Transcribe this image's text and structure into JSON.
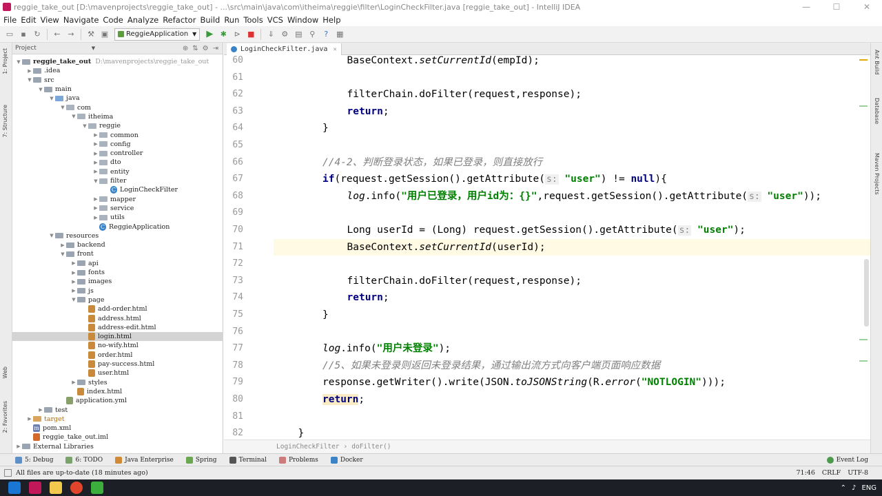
{
  "window": {
    "title": "reggie_take_out [D:\\mavenprojects\\reggie_take_out] - ...\\src\\main\\java\\com\\itheima\\reggie\\filter\\LoginCheckFilter.java [reggie_take_out] - IntelliJ IDEA",
    "minimize": "—",
    "maximize": "☐",
    "close": "✕"
  },
  "menu": [
    "File",
    "Edit",
    "View",
    "Navigate",
    "Code",
    "Analyze",
    "Refactor",
    "Build",
    "Run",
    "Tools",
    "VCS",
    "Window",
    "Help"
  ],
  "toolbar": {
    "run_config": "ReggieApplication"
  },
  "left_strip": {
    "project": "1: Project",
    "structure": "7: Structure",
    "web": "Web",
    "favorites": "2: Favorites"
  },
  "right_strip": {
    "ant": "Ant Build",
    "database": "Database",
    "maven": "Maven Projects"
  },
  "project_panel": {
    "header": "Project",
    "rows": [
      {
        "label": "reggie_take_out",
        "extra": "D:\\mavenprojects\\reggie_take_out",
        "arrow": "▼",
        "type": "folder",
        "bold": true
      },
      {
        "label": ".idea",
        "arrow": "▶",
        "type": "folder"
      },
      {
        "label": "src",
        "arrow": "▼",
        "type": "folder"
      },
      {
        "label": "main",
        "arrow": "▼",
        "type": "folder"
      },
      {
        "label": "java",
        "arrow": "▼",
        "type": "blue"
      },
      {
        "label": "com",
        "arrow": "▼",
        "type": "pkg"
      },
      {
        "label": "itheima",
        "arrow": "▼",
        "type": "pkg"
      },
      {
        "label": "reggie",
        "arrow": "▼",
        "type": "pkg"
      },
      {
        "label": "common",
        "arrow": "▶",
        "type": "pkg"
      },
      {
        "label": "config",
        "arrow": "▶",
        "type": "pkg"
      },
      {
        "label": "controller",
        "arrow": "▶",
        "type": "pkg"
      },
      {
        "label": "dto",
        "arrow": "▶",
        "type": "pkg"
      },
      {
        "label": "entity",
        "arrow": "▶",
        "type": "pkg"
      },
      {
        "label": "filter",
        "arrow": "▼",
        "type": "pkg"
      },
      {
        "label": "LoginCheckFilter",
        "arrow": "",
        "type": "class"
      },
      {
        "label": "mapper",
        "arrow": "▶",
        "type": "pkg"
      },
      {
        "label": "service",
        "arrow": "▶",
        "type": "pkg"
      },
      {
        "label": "utils",
        "arrow": "▶",
        "type": "pkg"
      },
      {
        "label": "ReggieApplication",
        "arrow": "",
        "type": "class"
      },
      {
        "label": "resources",
        "arrow": "▼",
        "type": "folder"
      },
      {
        "label": "backend",
        "arrow": "▶",
        "type": "folder"
      },
      {
        "label": "front",
        "arrow": "▼",
        "type": "folder"
      },
      {
        "label": "api",
        "arrow": "▶",
        "type": "folder"
      },
      {
        "label": "fonts",
        "arrow": "▶",
        "type": "folder"
      },
      {
        "label": "images",
        "arrow": "▶",
        "type": "folder"
      },
      {
        "label": "js",
        "arrow": "▶",
        "type": "folder"
      },
      {
        "label": "page",
        "arrow": "▼",
        "type": "folder"
      },
      {
        "label": "add-order.html",
        "arrow": "",
        "type": "html"
      },
      {
        "label": "address.html",
        "arrow": "",
        "type": "html"
      },
      {
        "label": "address-edit.html",
        "arrow": "",
        "type": "html"
      },
      {
        "label": "login.html",
        "arrow": "",
        "type": "html",
        "selected": true
      },
      {
        "label": "no-wify.html",
        "arrow": "",
        "type": "html"
      },
      {
        "label": "order.html",
        "arrow": "",
        "type": "html"
      },
      {
        "label": "pay-success.html",
        "arrow": "",
        "type": "html"
      },
      {
        "label": "user.html",
        "arrow": "",
        "type": "html"
      },
      {
        "label": "styles",
        "arrow": "▶",
        "type": "folder"
      },
      {
        "label": "index.html",
        "arrow": "",
        "type": "html"
      },
      {
        "label": "application.yml",
        "arrow": "",
        "type": "yml"
      },
      {
        "label": "test",
        "arrow": "▶",
        "type": "folder"
      },
      {
        "label": "target",
        "arrow": "▶",
        "type": "orange"
      },
      {
        "label": "pom.xml",
        "arrow": "",
        "type": "m"
      },
      {
        "label": "reggie_take_out.iml",
        "arrow": "",
        "type": "iml"
      },
      {
        "label": "External Libraries",
        "arrow": "▶",
        "type": "lib"
      }
    ]
  },
  "editor": {
    "tab": "LoginCheckFilter.java",
    "lines": [
      {
        "n": "60",
        "indent": 3,
        "tokens": [
          [
            "BaseContext.",
            ""
          ],
          [
            "setCurrentId",
            "it"
          ],
          [
            "(empId);",
            ""
          ]
        ]
      },
      {
        "n": "61",
        "indent": 0,
        "tokens": []
      },
      {
        "n": "62",
        "indent": 3,
        "tokens": [
          [
            "filterChain.doFilter(request,response);",
            ""
          ]
        ]
      },
      {
        "n": "63",
        "indent": 3,
        "tokens": [
          [
            "return",
            "kw"
          ],
          [
            ";",
            ""
          ]
        ]
      },
      {
        "n": "64",
        "indent": 2,
        "tokens": [
          [
            "}",
            ""
          ]
        ]
      },
      {
        "n": "65",
        "indent": 0,
        "tokens": []
      },
      {
        "n": "66",
        "indent": 2,
        "tokens": [
          [
            "//4-2、判断登录状态，如果已登录，则直接放行",
            "cm"
          ]
        ]
      },
      {
        "n": "67",
        "indent": 2,
        "tokens": [
          [
            "if",
            "kw"
          ],
          [
            "(request.getSession().getAttribute(",
            ""
          ],
          [
            "s:",
            "hint"
          ],
          [
            "\"user\"",
            "str"
          ],
          [
            ") != ",
            ""
          ],
          [
            "null",
            "kw"
          ],
          [
            "){",
            ""
          ]
        ]
      },
      {
        "n": "68",
        "indent": 3,
        "tokens": [
          [
            "log",
            "it"
          ],
          [
            ".info(",
            ""
          ],
          [
            "\"用户已登录，用户id为：{}\"",
            "str"
          ],
          [
            ",request.getSession().getAttribute(",
            ""
          ],
          [
            "s:",
            "hint"
          ],
          [
            "\"user\"",
            "str"
          ],
          [
            "));",
            ""
          ]
        ]
      },
      {
        "n": "69",
        "indent": 0,
        "tokens": []
      },
      {
        "n": "70",
        "indent": 3,
        "tokens": [
          [
            "Long userId = (Long) request.getSession().getAttribute(",
            ""
          ],
          [
            "s:",
            "hint"
          ],
          [
            "\"user\"",
            "str"
          ],
          [
            ");",
            ""
          ]
        ]
      },
      {
        "n": "71",
        "indent": 3,
        "tokens": [
          [
            "BaseContext.",
            ""
          ],
          [
            "setCurrentId",
            "it"
          ],
          [
            "(userId);",
            ""
          ]
        ],
        "current": true
      },
      {
        "n": "72",
        "indent": 0,
        "tokens": []
      },
      {
        "n": "73",
        "indent": 3,
        "tokens": [
          [
            "filterChain.doFilter(request,response);",
            ""
          ]
        ]
      },
      {
        "n": "74",
        "indent": 3,
        "tokens": [
          [
            "return",
            "kw"
          ],
          [
            ";",
            ""
          ]
        ]
      },
      {
        "n": "75",
        "indent": 2,
        "tokens": [
          [
            "}",
            ""
          ]
        ]
      },
      {
        "n": "76",
        "indent": 0,
        "tokens": []
      },
      {
        "n": "77",
        "indent": 2,
        "tokens": [
          [
            "log",
            "it"
          ],
          [
            ".info(",
            ""
          ],
          [
            "\"用户未登录\"",
            "str"
          ],
          [
            ");",
            ""
          ]
        ]
      },
      {
        "n": "78",
        "indent": 2,
        "tokens": [
          [
            "//5、如果未登录则返回未登录结果，通过输出流方式向客户端页面响应数据",
            "cm"
          ]
        ]
      },
      {
        "n": "79",
        "indent": 2,
        "tokens": [
          [
            "response.getWriter().write(JSON.",
            ""
          ],
          [
            "toJSONString",
            "it"
          ],
          [
            "(R.",
            ""
          ],
          [
            "error",
            "it"
          ],
          [
            "(",
            ""
          ],
          [
            "\"NOTLOGIN\"",
            "str"
          ],
          [
            ")));",
            ""
          ]
        ]
      },
      {
        "n": "80",
        "indent": 2,
        "tokens": [
          [
            "return",
            "kw ret"
          ],
          [
            ";",
            ""
          ]
        ]
      },
      {
        "n": "81",
        "indent": 0,
        "tokens": []
      },
      {
        "n": "82",
        "indent": 1,
        "tokens": [
          [
            "}",
            ""
          ]
        ]
      }
    ]
  },
  "breadcrumb": [
    "LoginCheckFilter",
    "doFilter()"
  ],
  "bottom_tabs": [
    "5: Debug",
    "6: TODO",
    "Java Enterprise",
    "Spring",
    "Terminal",
    "Problems",
    "Docker"
  ],
  "event_log": "Event Log",
  "status": {
    "message": "All files are up-to-date (18 minutes ago)",
    "position": "71:46",
    "line_sep": "CRLF",
    "encoding": "UTF-8"
  },
  "taskbar": {
    "lang": "ENG"
  }
}
